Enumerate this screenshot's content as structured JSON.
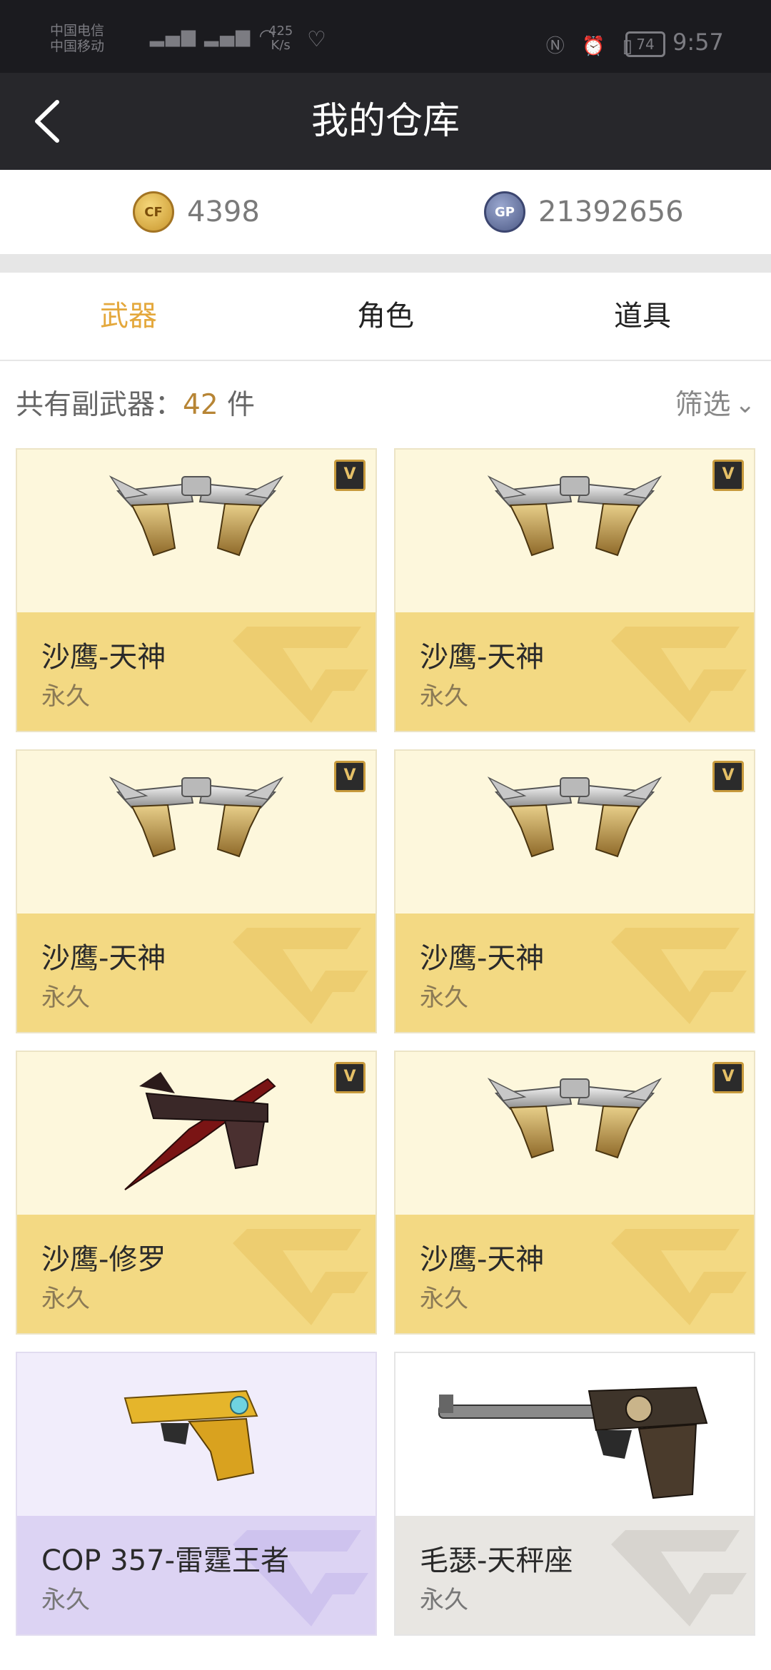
{
  "status_bar": {
    "carrier1": "中国电信",
    "carrier2": "中国移动",
    "net_speed": "425",
    "net_speed_unit": "K/s",
    "battery": "74",
    "time": "9:57"
  },
  "header": {
    "title": "我的仓库"
  },
  "currency": {
    "cf_points": "4398",
    "gp_points": "21392656",
    "gp_label": "GP"
  },
  "tabs": [
    {
      "label": "武器",
      "active": true
    },
    {
      "label": "角色",
      "active": false
    },
    {
      "label": "道具",
      "active": false
    }
  ],
  "summary": {
    "prefix": "共有副武器：",
    "count": "42",
    "suffix": " 件",
    "filter_label": "筛选"
  },
  "items": [
    {
      "name": "沙鹰-天神",
      "duration": "永久",
      "theme": "gold",
      "vip": true,
      "icon": "desert-eagle-tianshen-icon"
    },
    {
      "name": "沙鹰-天神",
      "duration": "永久",
      "theme": "gold",
      "vip": true,
      "icon": "desert-eagle-tianshen-icon"
    },
    {
      "name": "沙鹰-天神",
      "duration": "永久",
      "theme": "gold",
      "vip": true,
      "icon": "desert-eagle-tianshen-icon"
    },
    {
      "name": "沙鹰-天神",
      "duration": "永久",
      "theme": "gold",
      "vip": true,
      "icon": "desert-eagle-tianshen-icon"
    },
    {
      "name": "沙鹰-修罗",
      "duration": "永久",
      "theme": "gold",
      "vip": true,
      "icon": "desert-eagle-xiuluo-icon"
    },
    {
      "name": "沙鹰-天神",
      "duration": "永久",
      "theme": "gold",
      "vip": true,
      "icon": "desert-eagle-tianshen-icon"
    },
    {
      "name": "COP 357-雷霆王者",
      "duration": "永久",
      "theme": "purple",
      "vip": false,
      "icon": "cop357-icon"
    },
    {
      "name": "毛瑟-天秤座",
      "duration": "永久",
      "theme": "gray",
      "vip": false,
      "icon": "mauser-libra-icon"
    }
  ],
  "colors": {
    "accent": "#e4a83c",
    "header_bg": "#27272b",
    "gold_card": "#f3d983",
    "purple_card": "#dcd3f3",
    "gray_card": "#e8e6e2"
  }
}
